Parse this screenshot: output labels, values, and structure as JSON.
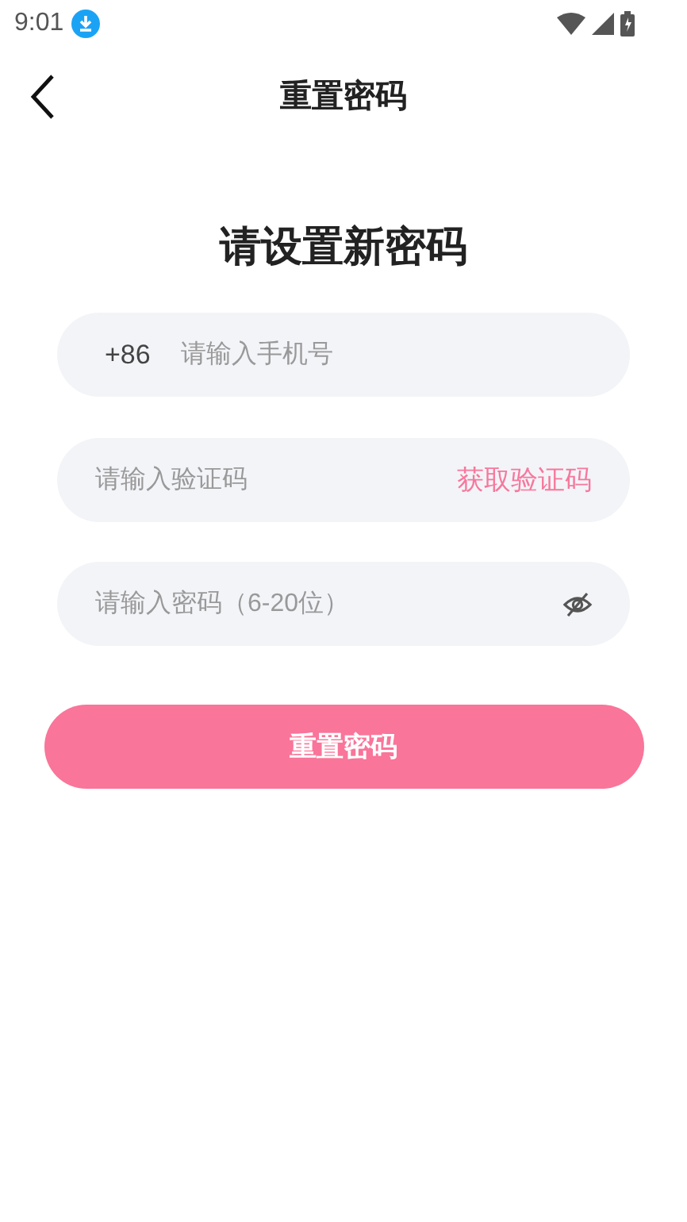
{
  "status_bar": {
    "time": "9:01"
  },
  "header": {
    "title": "重置密码"
  },
  "heading": "请设置新密码",
  "phone_field": {
    "prefix": "+86",
    "placeholder": "请输入手机号"
  },
  "code_field": {
    "placeholder": "请输入验证码",
    "action": "获取验证码"
  },
  "password_field": {
    "placeholder": "请输入密码（6-20位）",
    "password_visible": false
  },
  "submit_button": "重置密码"
}
